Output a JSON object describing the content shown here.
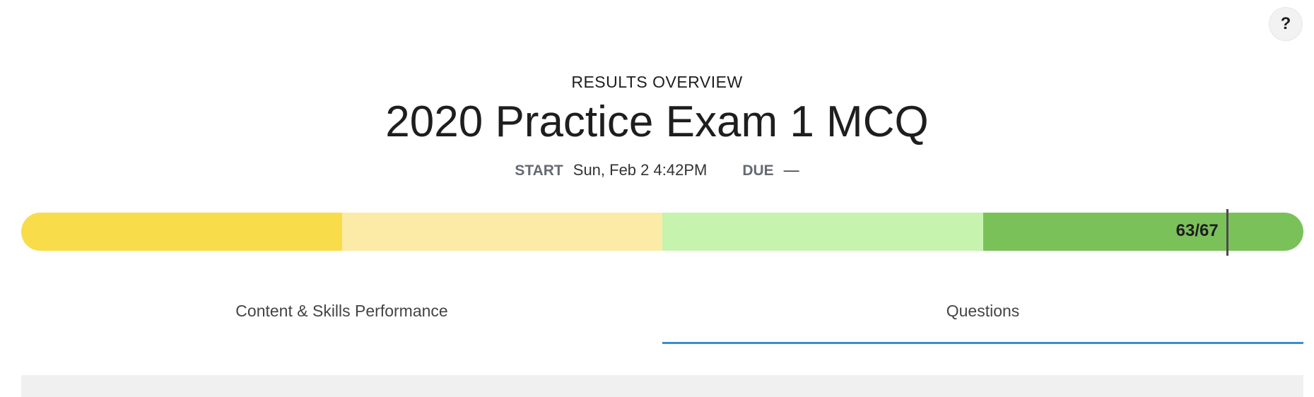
{
  "help": {
    "label": "?"
  },
  "header": {
    "subtitle": "RESULTS OVERVIEW",
    "title": "2020 Practice Exam 1 MCQ",
    "start_label": "START",
    "start_value": "Sun, Feb 2 4:42PM",
    "due_label": "DUE",
    "due_value": "—"
  },
  "progress": {
    "segment_colors": [
      "#f9dc4a",
      "#fbeba6",
      "#c6f3ae",
      "#7bc15a"
    ],
    "score_text": "63/67",
    "score": 63,
    "total": 67
  },
  "tabs": [
    {
      "label": "Content & Skills Performance",
      "active": false
    },
    {
      "label": "Questions",
      "active": true
    }
  ],
  "colors": {
    "active_tab_underline": "#3a8fc8"
  }
}
